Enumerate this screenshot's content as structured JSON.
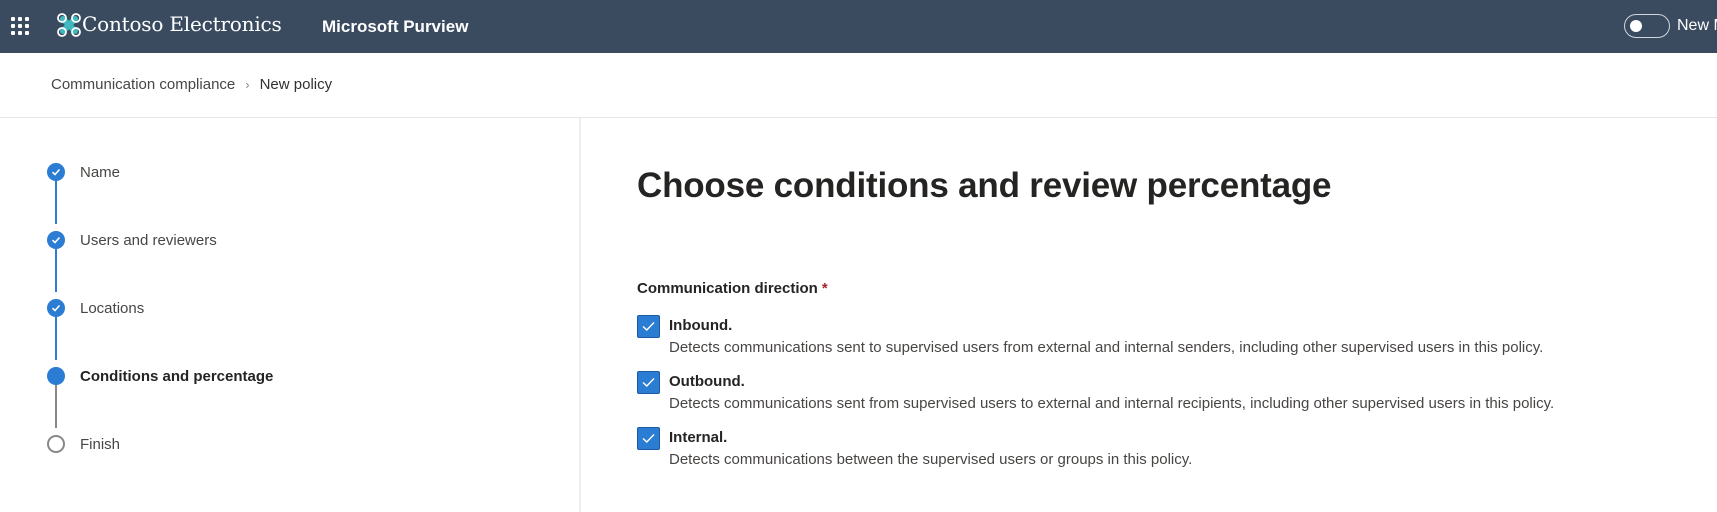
{
  "header": {
    "app_launcher_icon": "waffle-icon",
    "logo_icon": "contoso-logo-icon",
    "brand": "Contoso Electronics",
    "app_name": "Microsoft Purview",
    "toggle": {
      "label": "New M",
      "on": false
    }
  },
  "breadcrumb": {
    "items": [
      "Communication compliance",
      "New policy"
    ],
    "separator_icon": "chevron-right-icon"
  },
  "stepper": {
    "steps": [
      {
        "label": "Name",
        "state": "completed"
      },
      {
        "label": "Users and reviewers",
        "state": "completed"
      },
      {
        "label": "Locations",
        "state": "completed"
      },
      {
        "label": "Conditions and percentage",
        "state": "current"
      },
      {
        "label": "Finish",
        "state": "pending"
      }
    ]
  },
  "main": {
    "title": "Choose conditions and review percentage",
    "section": {
      "label": "Communication direction",
      "required_marker": "*",
      "options": [
        {
          "title": "Inbound.",
          "description": "Detects communications sent to supervised users from external and internal senders, including other supervised users in this policy.",
          "checked": true
        },
        {
          "title": "Outbound.",
          "description": "Detects communications sent from supervised users to external and internal recipients, including other supervised users in this policy.",
          "checked": true
        },
        {
          "title": "Internal.",
          "description": "Detects communications between the supervised users or groups in this policy.",
          "checked": true
        }
      ]
    }
  },
  "colors": {
    "header_bg": "#3a4b60",
    "accent": "#2b7cd3",
    "required": "#a4262c",
    "logo": "#3fb8c0"
  }
}
